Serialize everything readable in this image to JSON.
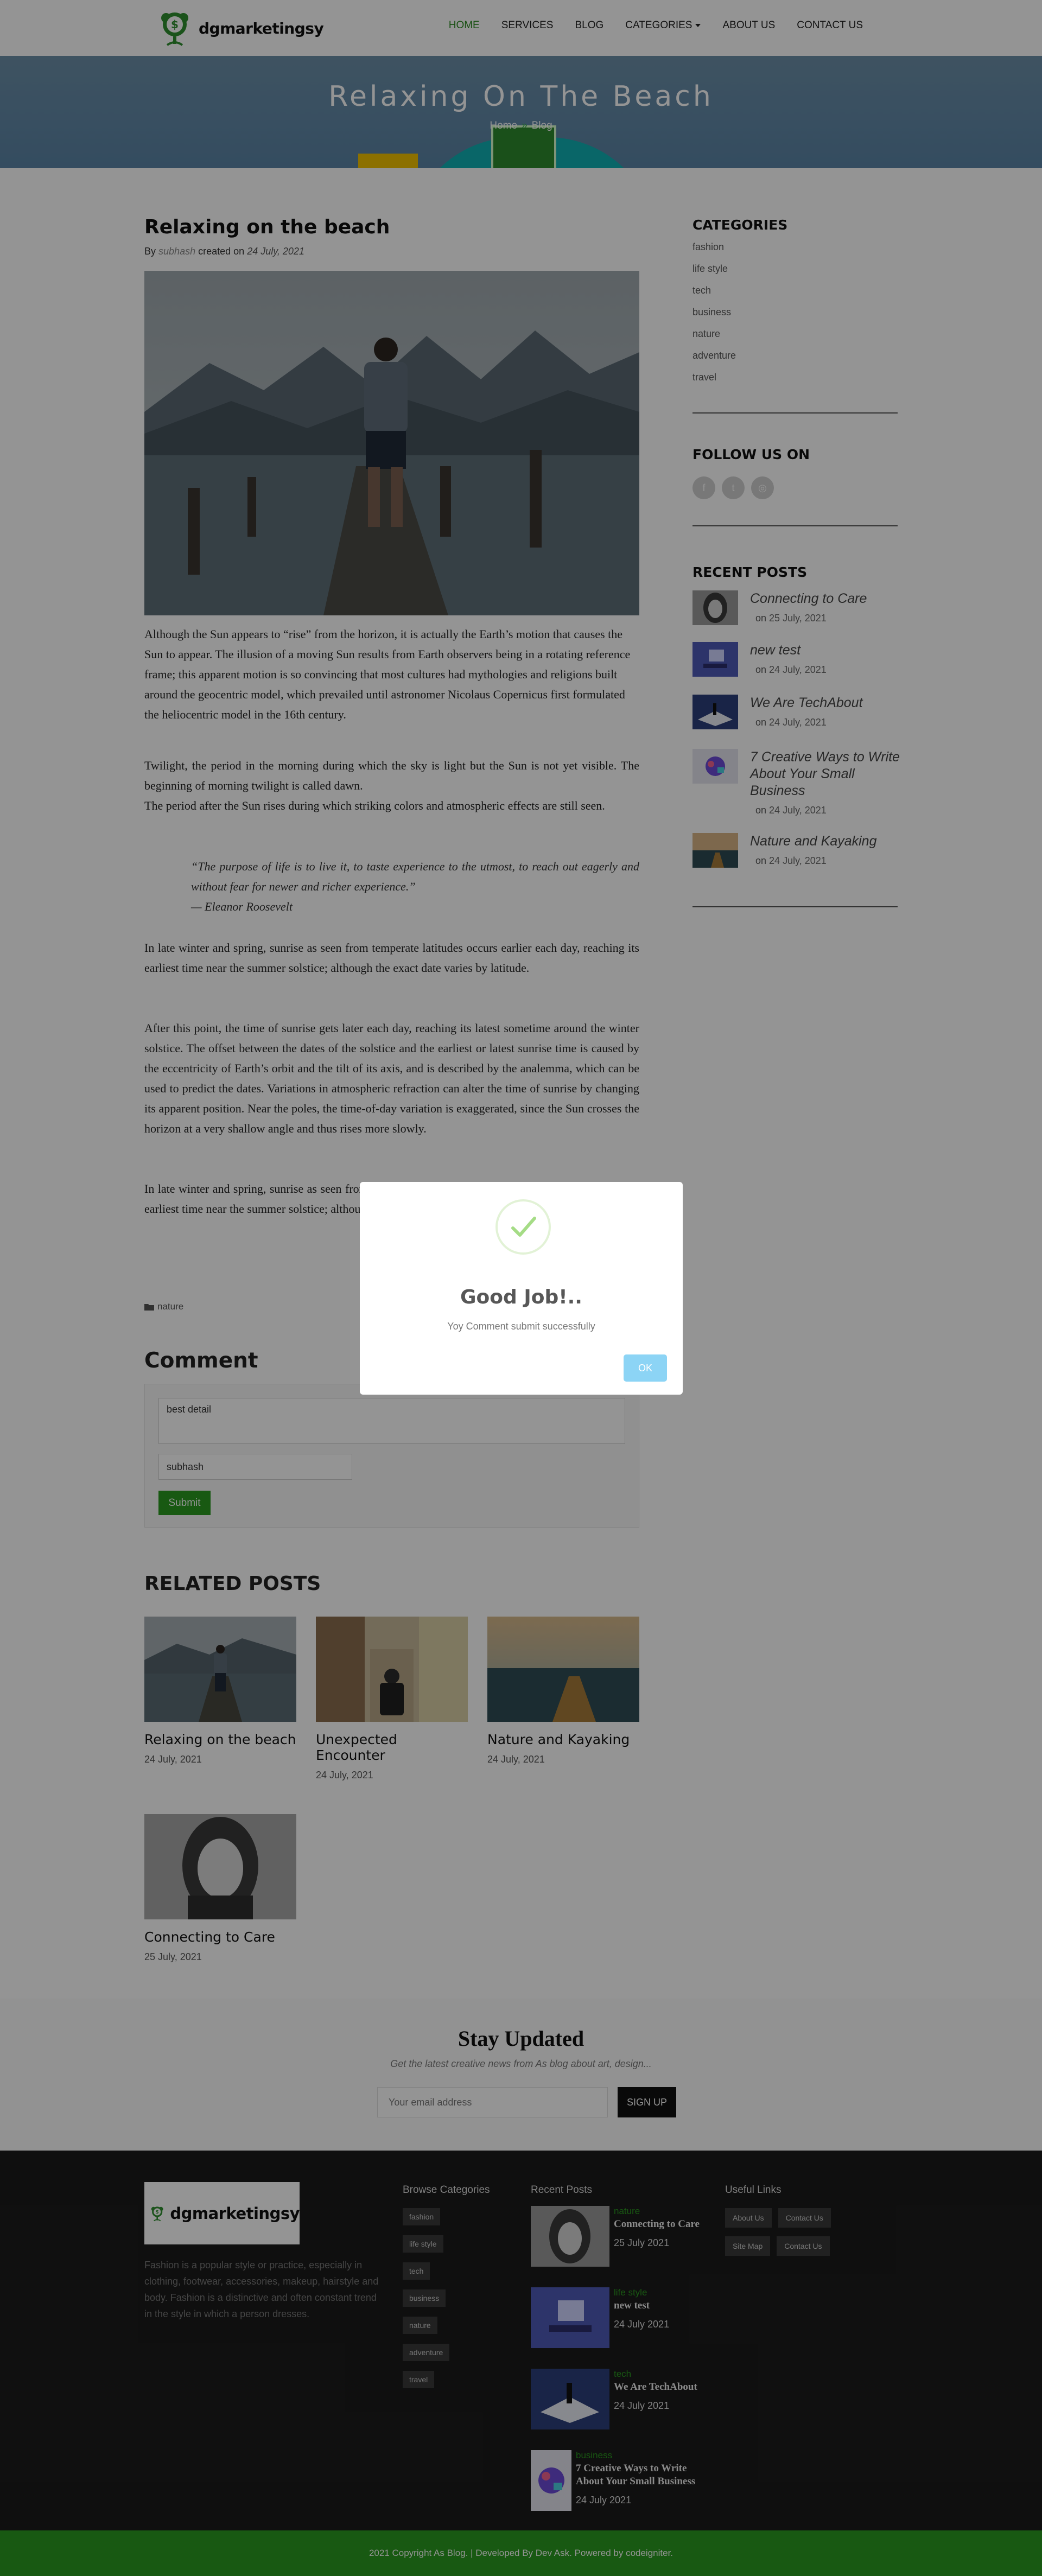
{
  "header": {
    "logo_text": "dgmarketingsy",
    "nav": [
      {
        "label": "HOME",
        "active": true
      },
      {
        "label": "SERVICES"
      },
      {
        "label": "BLOG"
      },
      {
        "label": "CATEGORIES"
      },
      {
        "label": "ABOUT US"
      },
      {
        "label": "CONTACT US"
      }
    ]
  },
  "hero": {
    "title": "Relaxing On The Beach",
    "crumb_home": "Home",
    "crumb_sep": "»",
    "crumb_current": "Blog"
  },
  "post": {
    "title": "Relaxing on the beach",
    "meta_by": "By",
    "author": "subhash",
    "meta_created": "created on",
    "date": "24 July, 2021",
    "p1": "Although the Sun appears to “rise” from the horizon, it is actually the Earth’s motion that causes the Sun to appear. The illusion of a moving Sun results from Earth observers being in a rotating reference frame; this apparent motion is so convincing that most cultures had mythologies and religions built around the geocentric model, which prevailed until astronomer Nicolaus Copernicus first formulated the heliocentric model in the 16th century.",
    "p2": "Twilight, the period in the morning during which the sky is light but the Sun is not yet visible. The beginning of morning twilight is called dawn.",
    "p3": "The period after the Sun rises during which striking colors and atmospheric effects are still seen.",
    "quote": "“The purpose of life is to live it, to taste experience to the utmost, to reach out eagerly and without fear for newer and richer experience.”",
    "quote_author": "— Eleanor Roosevelt",
    "p4": "In late winter and spring, sunrise as seen from temperate latitudes occurs earlier each day, reaching its earliest time near the summer solstice; although the exact date varies by latitude.",
    "p5": "After this point, the time of sunrise gets later each day, reaching its latest sometime around the winter solstice. The offset between the dates of the solstice and the earliest or latest sunrise time is caused by the eccentricity of Earth’s orbit and the tilt of its axis, and is described by the analemma, which can be used to predict the dates. Variations in atmospheric refraction can alter the time of sunrise by changing its apparent position. Near the poles, the time-of-day variation is exaggerated, since the Sun crosses the horizon at a very shallow angle and thus rises more slowly.",
    "p6": "In late winter and spring, sunrise as seen from temperate latitudes occurs earlier each day, reaching its earliest time near the summer solstice; although the exact date varies by latitude.",
    "tag": "nature"
  },
  "comment": {
    "title": "Comment",
    "text_value": "best detail",
    "name_value": "subhash",
    "submit": "Submit"
  },
  "related": {
    "title": "RELATED POSTS",
    "items": [
      {
        "title": "Relaxing on the beach",
        "date": "24 July, 2021"
      },
      {
        "title": "Unexpected Encounter",
        "date": "24 July, 2021"
      },
      {
        "title": "Nature and Kayaking",
        "date": "24 July, 2021"
      },
      {
        "title": "Connecting to Care",
        "date": "25 July, 2021"
      }
    ]
  },
  "sidebar": {
    "categories_title": "CATEGORIES",
    "categories": [
      "fashion",
      "life style",
      "tech",
      "business",
      "nature",
      "adventure",
      "travel"
    ],
    "follow_title": "FOLLOW US ON",
    "recent_title": "RECENT POSTS",
    "recent": [
      {
        "title": "Connecting to Care",
        "on": "on",
        "date": "25 July, 2021"
      },
      {
        "title": "new test",
        "on": "on",
        "date": "24 July, 2021"
      },
      {
        "title": "We Are TechAbout",
        "on": "on",
        "date": "24 July, 2021"
      },
      {
        "title": "7 Creative Ways to Write About Your Small Business",
        "on": "on",
        "date": "24 July, 2021"
      },
      {
        "title": "Nature and Kayaking",
        "on": "on",
        "date": "24 July, 2021"
      }
    ]
  },
  "newsletter": {
    "title": "Stay Updated",
    "subtitle": "Get the latest creative news from As blog about art, design...",
    "placeholder": "Your email address",
    "button": "SIGN UP"
  },
  "footer": {
    "logo_text": "dgmarketingsy",
    "description": "Fashion is a popular style or practice, especially in clothing, footwear, accessories, makeup, hairstyle and body. Fashion is a distinctive and often constant trend in the style in which a person dresses.",
    "browse_title": "Browse Categories",
    "categories": [
      "fashion",
      "life style",
      "tech",
      "business",
      "nature",
      "adventure",
      "travel"
    ],
    "recent_title": "Recent Posts",
    "recent": [
      {
        "category": "nature",
        "title": "Connecting to Care",
        "date": "25 July 2021"
      },
      {
        "category": "life style",
        "title": "new test",
        "date": "24 July 2021"
      },
      {
        "category": "tech",
        "title": "We Are TechAbout",
        "date": "24 July 2021"
      },
      {
        "category": "business",
        "title": "7 Creative Ways to Write About Your Small Business",
        "date": "24 July 2021"
      }
    ],
    "links_title": "Useful Links",
    "links": [
      "About Us",
      "Contact Us",
      "Site Map",
      "Contact Us"
    ],
    "copyright": "2021 Copyright As Blog. | Developed By Dev Ask. Powered by codeigniter."
  },
  "modal": {
    "title": "Good Job!..",
    "message": "Yoy Comment submit successfully",
    "ok": "OK"
  },
  "colors": {
    "accent": "#2a9a1f",
    "overlay": "rgba(0,0,0,0.42)",
    "ok_button": "#8cd4f5"
  }
}
